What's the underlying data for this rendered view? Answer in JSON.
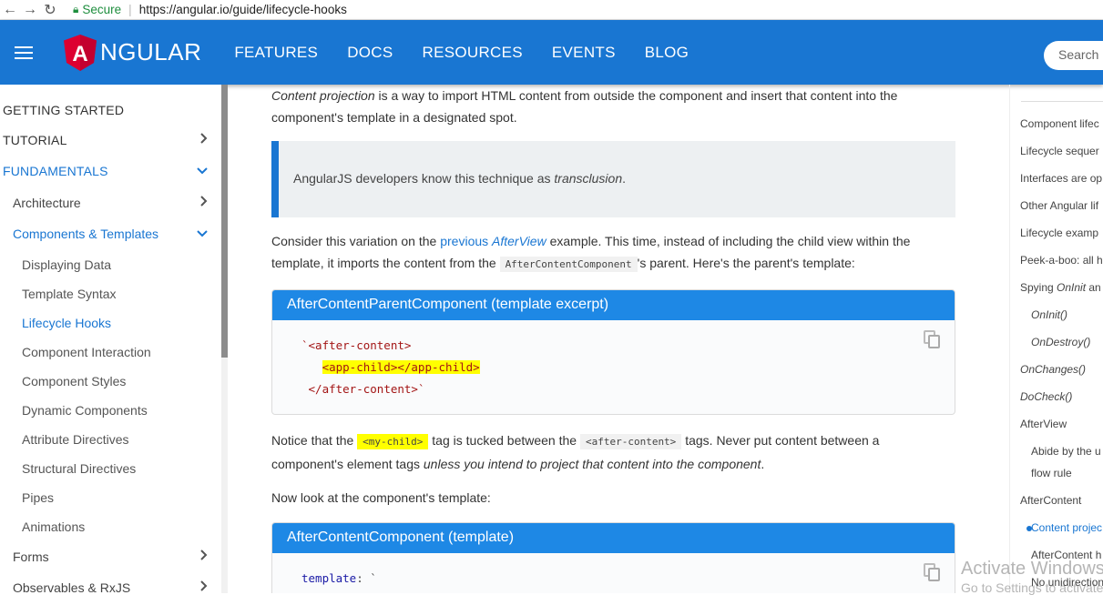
{
  "browser": {
    "secure_label": "Secure",
    "url": "https://angular.io/guide/lifecycle-hooks"
  },
  "header": {
    "logo_text": "NGULAR",
    "logo_letter": "A",
    "nav": [
      "FEATURES",
      "DOCS",
      "RESOURCES",
      "EVENTS",
      "BLOG"
    ],
    "search_placeholder": "Search"
  },
  "sidebar": {
    "items": [
      {
        "label": "GETTING STARTED",
        "level": "top",
        "chevron": ""
      },
      {
        "label": "TUTORIAL",
        "level": "top",
        "chevron": "right"
      },
      {
        "label": "FUNDAMENTALS",
        "level": "top",
        "chevron": "down",
        "active": true
      },
      {
        "label": "Architecture",
        "level": "lvl1",
        "chevron": "right"
      },
      {
        "label": "Components & Templates",
        "level": "lvl1",
        "chevron": "down",
        "active": true
      },
      {
        "label": "Displaying Data",
        "level": "lvl2"
      },
      {
        "label": "Template Syntax",
        "level": "lvl2"
      },
      {
        "label": "Lifecycle Hooks",
        "level": "lvl2",
        "active": true
      },
      {
        "label": "Component Interaction",
        "level": "lvl2"
      },
      {
        "label": "Component Styles",
        "level": "lvl2"
      },
      {
        "label": "Dynamic Components",
        "level": "lvl2"
      },
      {
        "label": "Attribute Directives",
        "level": "lvl2"
      },
      {
        "label": "Structural Directives",
        "level": "lvl2"
      },
      {
        "label": "Pipes",
        "level": "lvl2"
      },
      {
        "label": "Animations",
        "level": "lvl2"
      },
      {
        "label": "Forms",
        "level": "lvl1",
        "chevron": "right"
      },
      {
        "label": "Observables & RxJS",
        "level": "lvl1",
        "chevron": "right"
      }
    ]
  },
  "content": {
    "intro_em": "Content projection",
    "intro_rest": " is a way to import HTML content from outside the component and insert that content into the component's template in a designated spot.",
    "callout_text": "AngularJS developers know this technique as ",
    "callout_em": "transclusion",
    "callout_end": ".",
    "para2_a": "Consider this variation on the ",
    "para2_link1": "previous ",
    "para2_link2": "AfterView",
    "para2_b": " example. This time, instead of including the child view within the template, it imports the content from the ",
    "para2_code": "AfterContentComponent",
    "para2_c": "'s parent. Here's the parent's template:",
    "code1_title": "AfterContentParentComponent (template excerpt)",
    "code1_line1": "`<after-content>",
    "code1_line2": "<app-child></app-child>",
    "code1_line3": "</after-content>`",
    "para3_a": "Notice that the ",
    "para3_code1": "<my-child>",
    "para3_b": " tag is tucked between the ",
    "para3_code2": "<after-content>",
    "para3_c": " tags. Never put content between a component's element tags ",
    "para3_em": "unless you intend to project that content into the component",
    "para3_d": ".",
    "para4": "Now look at the component's template:",
    "code2_title": "AfterContentComponent (template)",
    "code2_line1_kw": "template",
    "code2_line1_rest": ": `"
  },
  "toc": {
    "items": [
      {
        "label": "Component lifec",
        "sub": false
      },
      {
        "label": "Lifecycle sequer",
        "sub": false
      },
      {
        "label": "Interfaces are op",
        "sub": false
      },
      {
        "label": "Other Angular lif",
        "sub": false
      },
      {
        "label": "Lifecycle examp",
        "sub": false
      },
      {
        "label": "Peek-a-boo: all h",
        "sub": false
      },
      {
        "label_a": "Spying ",
        "label_em": "OnInit",
        "label_b": " an",
        "sub": false
      },
      {
        "label_em": "OnInit()",
        "sub": true
      },
      {
        "label_em": "OnDestroy()",
        "sub": true
      },
      {
        "label_em": "OnChanges()",
        "sub": false
      },
      {
        "label_em": "DoCheck()",
        "sub": false
      },
      {
        "label": "AfterView",
        "sub": false
      },
      {
        "label": "Abide by the u",
        "sub": true
      },
      {
        "label": "flow rule",
        "sub": true
      },
      {
        "label": "AfterContent",
        "sub": false
      },
      {
        "label": "Content projec",
        "sub": true,
        "active": true
      },
      {
        "label": "AfterContent h",
        "sub": true
      },
      {
        "label": "No unidirection",
        "sub": true
      }
    ]
  },
  "watermark": {
    "line1": "Activate Windows",
    "line2": "Go to Settings to activate"
  },
  "colors": {
    "primary": "#1976d2",
    "code_header": "#1e88e5",
    "highlight": "#ffff00",
    "logo_red": "#dd0031"
  }
}
